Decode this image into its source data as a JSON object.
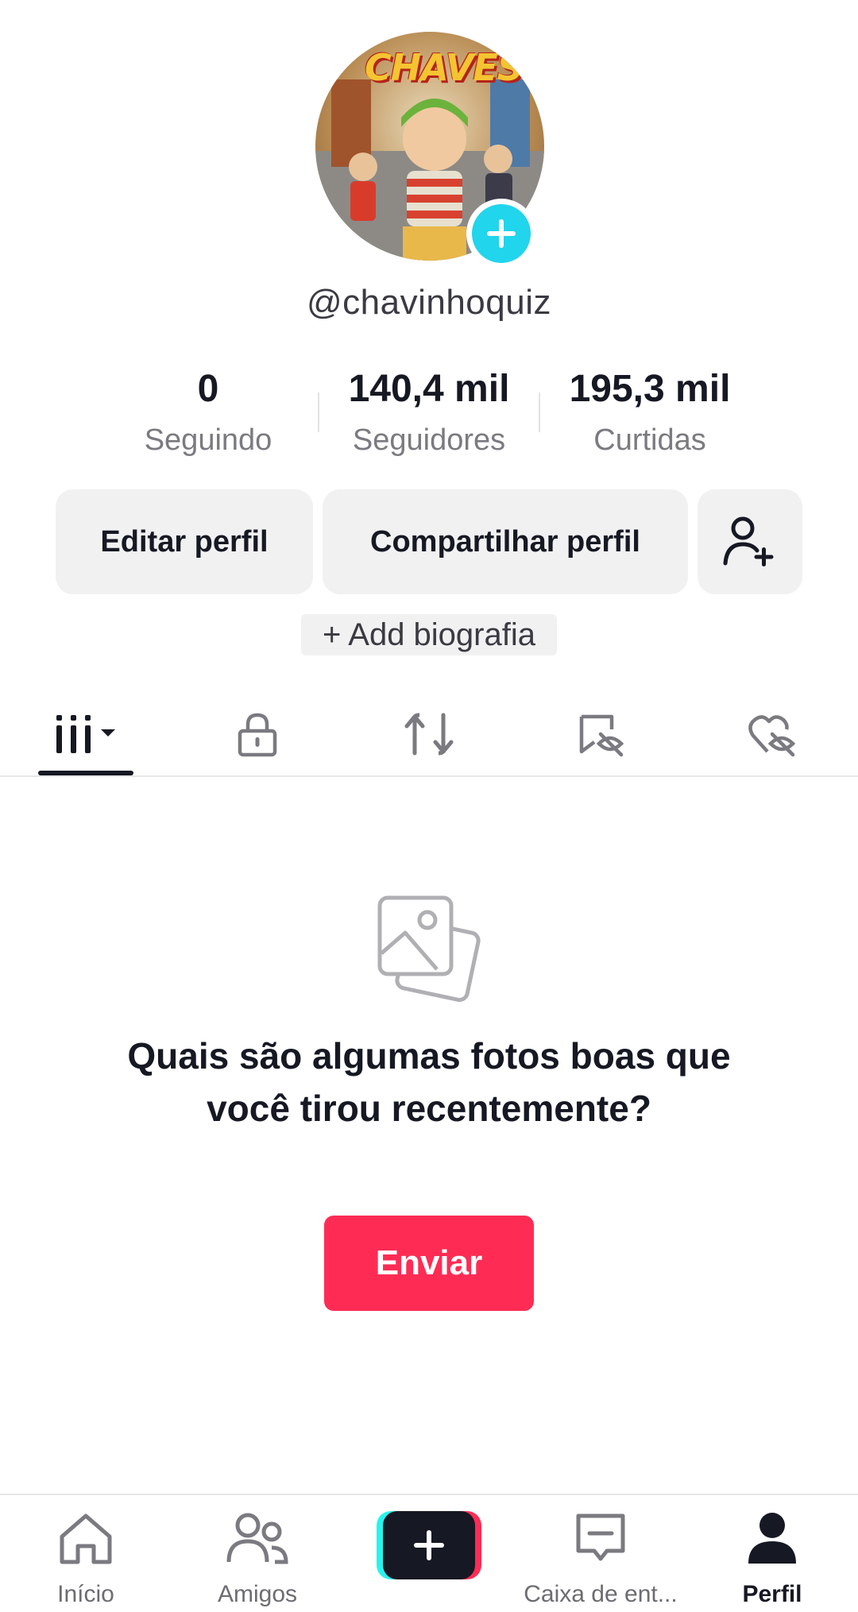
{
  "profile": {
    "username": "@chavinhoquiz",
    "avatar_logo": "CHAVES",
    "avatar_add_icon": "plus-icon"
  },
  "stats": [
    {
      "value": "0",
      "label": "Seguindo"
    },
    {
      "value": "140,4 mil",
      "label": "Seguidores"
    },
    {
      "value": "195,3 mil",
      "label": "Curtidas"
    }
  ],
  "actions": {
    "edit_label": "Editar perfil",
    "share_label": "Compartilhar perfil",
    "add_friend_icon": "add-user-icon"
  },
  "bio": {
    "add_label": "+ Add biografia"
  },
  "tabs": [
    {
      "name": "videos",
      "icon": "grid-icon",
      "active": true
    },
    {
      "name": "private",
      "icon": "lock-icon",
      "active": false
    },
    {
      "name": "reposts",
      "icon": "repost-icon",
      "active": false
    },
    {
      "name": "favorites",
      "icon": "bookmark-hidden-icon",
      "active": false
    },
    {
      "name": "liked",
      "icon": "heart-hidden-icon",
      "active": false
    }
  ],
  "empty_state": {
    "icon": "photos-icon",
    "title": "Quais são algumas fotos boas que você tirou recentemente?",
    "button_label": "Enviar"
  },
  "bottom_nav": [
    {
      "label": "Início",
      "icon": "home-icon",
      "active": false
    },
    {
      "label": "Amigos",
      "icon": "friends-icon",
      "active": false
    },
    {
      "label": "",
      "icon": "create-plus-icon",
      "active": false
    },
    {
      "label": "Caixa de ent...",
      "icon": "inbox-icon",
      "active": false
    },
    {
      "label": "Perfil",
      "icon": "profile-icon",
      "active": true
    }
  ],
  "colors": {
    "accent": "#fe2c55",
    "cyan": "#25f4ee",
    "badge": "#20d5ec",
    "text": "#161823",
    "muted": "#7a7a80",
    "button_bg": "#f1f1f2"
  }
}
